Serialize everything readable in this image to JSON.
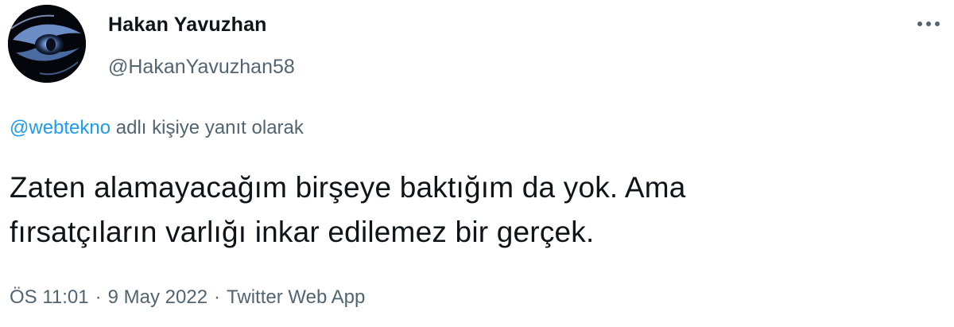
{
  "author": {
    "display_name": "Hakan Yavuzhan",
    "handle": "@HakanYavuzhan58",
    "avatar_icon": "glowing-eye-avatar-icon"
  },
  "menu": {
    "icon": "more-options-icon"
  },
  "reply": {
    "mention": "@webtekno",
    "suffix": " adlı kişiye yanıt olarak"
  },
  "tweet": {
    "line1": "Zaten alamayacağım birşeye baktığım da yok. Ama",
    "line2": "fırsatçıların varlığı inkar edilemez bir gerçek."
  },
  "meta": {
    "time": "ÖS 11:01",
    "separator": "·",
    "date": "9 May 2022",
    "source": "Twitter Web App"
  },
  "colors": {
    "link": "#1d9bf0",
    "secondary_text": "#536471",
    "primary_text": "#0f1419"
  }
}
